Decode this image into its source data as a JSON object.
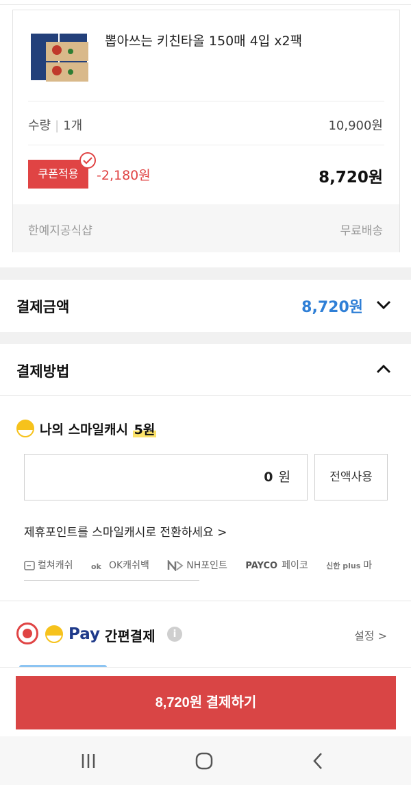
{
  "product": {
    "title": "뽑아쓰는 키친타올 150매 4입 x2팩",
    "quantity_label": "수량",
    "quantity_value": "1개",
    "unit_price": "10,900원",
    "coupon_label": "쿠폰적용",
    "discount": "-2,180원",
    "final_price": "8,720원",
    "seller": "한예지공식샵",
    "shipping": "무료배송"
  },
  "payment_amount": {
    "title": "결제금액",
    "amount": "8,720원"
  },
  "payment_method": {
    "title": "결제방법",
    "smile_cash": {
      "label": "나의 스마일캐시",
      "balance": "5원",
      "input_value": "0",
      "input_unit": "원",
      "use_all_label": "전액사용"
    },
    "convert_link": "제휴포인트를 스마일캐시로 전환하세요 >",
    "partners": [
      {
        "label": "컬쳐캐쉬",
        "icon": "culture-cash-icon"
      },
      {
        "label": "OK캐쉬백",
        "icon": "ok-cashbag-icon"
      },
      {
        "label": "NH포인트",
        "icon": "nh-point-icon"
      },
      {
        "label": "페이코",
        "logo": "PAYCO"
      },
      {
        "label": "마",
        "logo": "신한 plus"
      }
    ],
    "smile_pay": {
      "pay_word": "Pay",
      "label": "간편결제",
      "settings": "설정 >"
    }
  },
  "checkout": {
    "button_label": "8,720원 결제하기"
  },
  "colors": {
    "accent_red": "#d94545",
    "price_blue": "#2f7fd6",
    "smile_yellow": "#f6c21c"
  }
}
